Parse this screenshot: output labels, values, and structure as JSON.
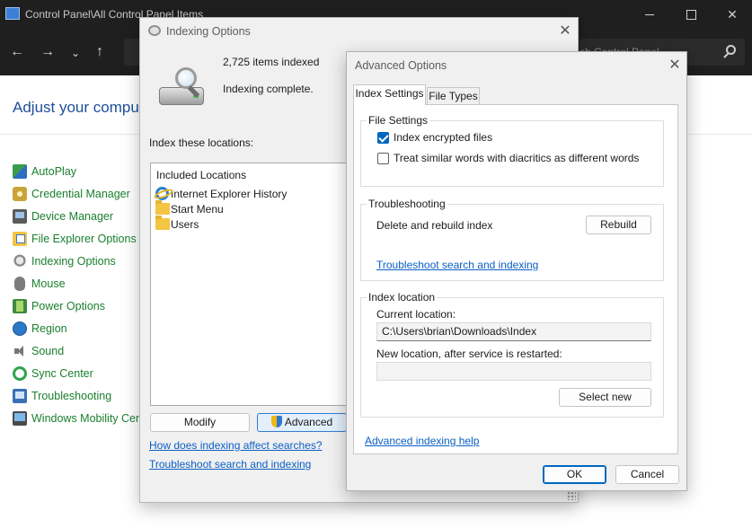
{
  "control_panel": {
    "title": "Control Panel\\All Control Panel Items",
    "search_placeholder": "ch Control Panel",
    "heading": "Adjust your compute",
    "items": [
      {
        "label": "AutoPlay",
        "icon": "autoplay-icon"
      },
      {
        "label": "Credential Manager",
        "icon": "credential-manager-icon"
      },
      {
        "label": "Device Manager",
        "icon": "device-manager-icon"
      },
      {
        "label": "File Explorer Options",
        "icon": "file-explorer-options-icon"
      },
      {
        "label": "Indexing Options",
        "icon": "indexing-options-icon"
      },
      {
        "label": "Mouse",
        "icon": "mouse-icon"
      },
      {
        "label": "Power Options",
        "icon": "power-options-icon"
      },
      {
        "label": "Region",
        "icon": "region-icon"
      },
      {
        "label": "Sound",
        "icon": "sound-icon"
      },
      {
        "label": "Sync Center",
        "icon": "sync-center-icon"
      },
      {
        "label": "Troubleshooting",
        "icon": "troubleshooting-icon"
      },
      {
        "label": "Windows Mobility Cen",
        "icon": "windows-mobility-center-icon"
      }
    ]
  },
  "indexing_options": {
    "title": "Indexing Options",
    "items_indexed": "2,725 items indexed",
    "status": "Indexing complete.",
    "locations_label": "Index these locations:",
    "list_header": "Included Locations",
    "locations": [
      {
        "label": "Internet Explorer History",
        "icon": "internet-explorer-icon"
      },
      {
        "label": "Start Menu",
        "icon": "folder-icon"
      },
      {
        "label": "Users",
        "icon": "folder-icon"
      }
    ],
    "modify_label": "Modify",
    "advanced_label": "Advanced",
    "link_how": "How does indexing affect searches?",
    "link_troubleshoot": "Troubleshoot search and indexing"
  },
  "advanced_options": {
    "title": "Advanced Options",
    "tabs": {
      "index_settings": "Index Settings",
      "file_types": "File Types"
    },
    "file_settings": {
      "title": "File Settings",
      "encrypt_label": "Index encrypted files",
      "encrypt_checked": true,
      "diacritics_label": "Treat similar words with diacritics as different words",
      "diacritics_checked": false
    },
    "troubleshooting": {
      "title": "Troubleshooting",
      "rebuild_text": "Delete and rebuild index",
      "rebuild_label": "Rebuild",
      "link": "Troubleshoot search and indexing"
    },
    "index_location": {
      "title": "Index location",
      "current_label": "Current location:",
      "current_value": "C:\\Users\\brian\\Downloads\\Index",
      "new_label": "New location, after service is restarted:",
      "new_value": "",
      "select_new_label": "Select new"
    },
    "help_link": "Advanced indexing help",
    "ok_label": "OK",
    "cancel_label": "Cancel"
  }
}
